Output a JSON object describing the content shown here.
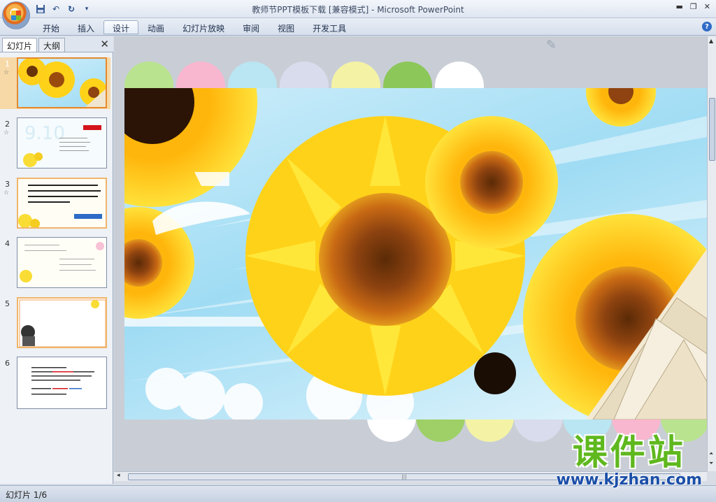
{
  "window": {
    "title": "教师节PPT模板下载 [兼容模式] - Microsoft PowerPoint"
  },
  "quick_access": [
    {
      "icon": "save-icon"
    },
    {
      "icon": "undo-icon"
    },
    {
      "icon": "redo-icon"
    },
    {
      "icon": "customize-dropdown-icon"
    }
  ],
  "ribbon": {
    "tabs": [
      "开始",
      "插入",
      "设计",
      "动画",
      "幻灯片放映",
      "审阅",
      "视图",
      "开发工具"
    ],
    "active_tab": "设计"
  },
  "panel": {
    "tabs": [
      "幻灯片",
      "大纲"
    ],
    "close": "✕"
  },
  "slides": [
    {
      "number": "1",
      "selected": true
    },
    {
      "number": "2",
      "selected": false
    },
    {
      "number": "3",
      "selected": false
    },
    {
      "number": "4",
      "selected": false
    },
    {
      "number": "5",
      "selected": false
    },
    {
      "number": "6",
      "selected": false
    }
  ],
  "watermark": {
    "title": "课件站",
    "url": "www.kjzhan.com"
  },
  "status": {
    "slide_indicator": "幻灯片 1/6"
  },
  "colors": {
    "dots_top": [
      "#b9e38f",
      "#f9b6cf",
      "#b9e6f2",
      "#d9dcec",
      "#f4f3a5",
      "#8cc75a",
      "#ffffff"
    ],
    "dots_bottom": [
      "#ffffff",
      "#9ed067",
      "#f4f3a5",
      "#d9dcec",
      "#b9e6f2",
      "#f9b6cf",
      "#b9e38f"
    ],
    "sunflower_petal": "#ffd21a",
    "sunflower_center": "#9b4a0e",
    "selection": "#f7d9a8"
  }
}
